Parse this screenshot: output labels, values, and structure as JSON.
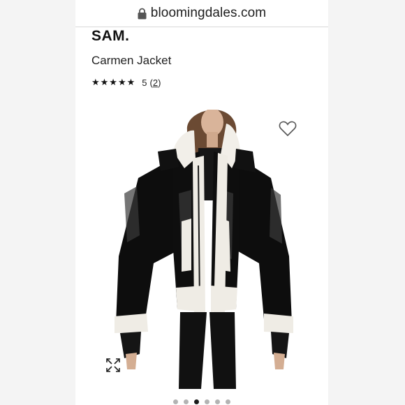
{
  "browser": {
    "url": "bloomingdales.com",
    "lock_icon": "lock-icon"
  },
  "product": {
    "brand": "SAM.",
    "name": "Carmen Jacket",
    "stars": "★★★★★",
    "rating_value": "5",
    "review_count_open": "(",
    "review_count": "2",
    "review_count_close": ")"
  },
  "icons": {
    "favorite": "heart-icon",
    "expand": "expand-arrows-icon"
  },
  "gallery": {
    "image_count": 6,
    "active_index": 2
  },
  "colors": {
    "page_bg": "#f3f3f3",
    "panel_bg": "#ffffff",
    "text": "#111111",
    "dot_active": "#1a1a1a",
    "dot_inactive": "#b3b3b3"
  }
}
